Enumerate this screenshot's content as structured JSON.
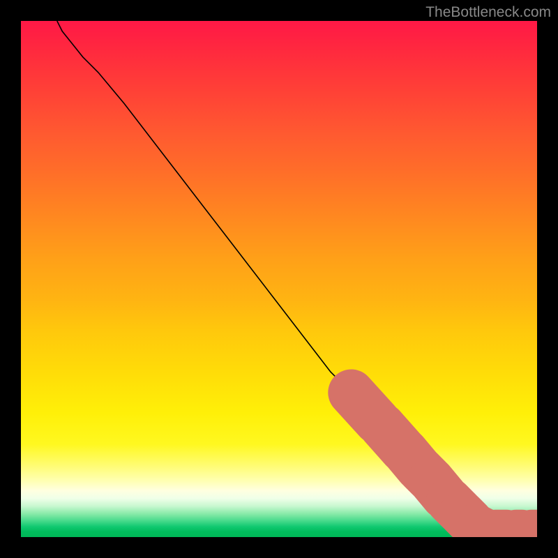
{
  "watermark": "TheBottleneck.com",
  "chart_data": {
    "type": "line",
    "title": "",
    "xlabel": "",
    "ylabel": "",
    "xlim": [
      0,
      100
    ],
    "ylim": [
      0,
      100
    ],
    "curve_points": [
      {
        "x": 7,
        "y": 100
      },
      {
        "x": 8,
        "y": 98
      },
      {
        "x": 10,
        "y": 95.5
      },
      {
        "x": 12,
        "y": 93
      },
      {
        "x": 15,
        "y": 90
      },
      {
        "x": 20,
        "y": 84
      },
      {
        "x": 25,
        "y": 77.5
      },
      {
        "x": 30,
        "y": 71
      },
      {
        "x": 35,
        "y": 64.5
      },
      {
        "x": 40,
        "y": 58
      },
      {
        "x": 45,
        "y": 51.5
      },
      {
        "x": 50,
        "y": 45
      },
      {
        "x": 55,
        "y": 38.5
      },
      {
        "x": 60,
        "y": 32
      },
      {
        "x": 65,
        "y": 27
      },
      {
        "x": 70,
        "y": 21.5
      },
      {
        "x": 75,
        "y": 16
      },
      {
        "x": 80,
        "y": 10.5
      },
      {
        "x": 85,
        "y": 5
      },
      {
        "x": 88,
        "y": 2
      },
      {
        "x": 90,
        "y": 1
      },
      {
        "x": 93,
        "y": 0.8
      },
      {
        "x": 97,
        "y": 0.8
      },
      {
        "x": 100,
        "y": 0.8
      }
    ],
    "highlighted_segments": [
      {
        "x1": 64,
        "y1": 28,
        "x2": 69,
        "y2": 22.5
      },
      {
        "x1": 70,
        "y1": 21.5,
        "x2": 74,
        "y2": 17
      },
      {
        "x1": 74.5,
        "y1": 16.5,
        "x2": 77,
        "y2": 13.5
      },
      {
        "x1": 77.5,
        "y1": 13,
        "x2": 79,
        "y2": 11.5
      },
      {
        "x1": 79.5,
        "y1": 11,
        "x2": 82,
        "y2": 8
      },
      {
        "x1": 83,
        "y1": 7,
        "x2": 85,
        "y2": 5
      },
      {
        "x1": 85.5,
        "y1": 4.5,
        "x2": 87,
        "y2": 3
      },
      {
        "x1": 88,
        "y1": 2,
        "x2": 90,
        "y2": 1
      },
      {
        "x1": 92,
        "y1": 0.8,
        "x2": 94,
        "y2": 0.8
      },
      {
        "x1": 96,
        "y1": 0.8,
        "x2": 97,
        "y2": 0.8
      },
      {
        "x1": 99,
        "y1": 0.8,
        "x2": 100,
        "y2": 0.8
      }
    ],
    "highlight_color": "#d67268"
  }
}
